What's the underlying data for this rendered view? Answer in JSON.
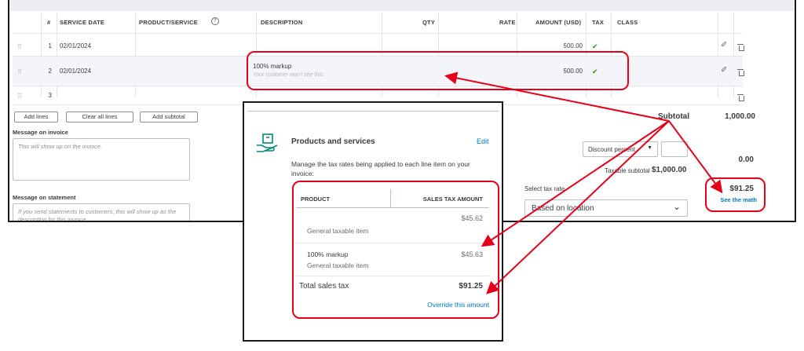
{
  "table": {
    "headers": {
      "num": "#",
      "service_date": "SERVICE DATE",
      "product_service": "PRODUCT/SERVICE",
      "description": "DESCRIPTION",
      "qty": "QTY",
      "rate": "RATE",
      "amount": "AMOUNT (USD)",
      "tax": "TAX",
      "class": "CLASS"
    },
    "rows": [
      {
        "num": "1",
        "date": "02/01/2024",
        "description": "",
        "description_sub": "",
        "amount": "500.00",
        "tax": "✔"
      },
      {
        "num": "2",
        "date": "02/01/2024",
        "description": "100% markup",
        "description_sub": "Your customer won't see this.",
        "amount": "500.00",
        "tax": "✔"
      },
      {
        "num": "3",
        "date": "",
        "description": "",
        "description_sub": "",
        "amount": "",
        "tax": ""
      }
    ]
  },
  "actions": {
    "add_lines": "Add lines",
    "clear_all_lines": "Clear all lines",
    "add_subtotal": "Add subtotal"
  },
  "message_invoice": {
    "label": "Message on invoice",
    "placeholder": "This will show up on the invoice."
  },
  "message_statement": {
    "label": "Message on statement",
    "placeholder": "If you send statements to customers, this will show up as the description for this invoice."
  },
  "totals": {
    "subtotal_label": "Subtotal",
    "subtotal_value": "1,000.00",
    "discount_label": "Discount percent",
    "discount_value": "0.00",
    "taxable_subtotal_label": "Taxable subtotal",
    "taxable_subtotal_value": "$1,000.00",
    "select_tax_rate_label": "Select tax rate",
    "tax_rate_value": "Based on location",
    "tax_total": "$91.25",
    "see_the_math": "See the math"
  },
  "popup": {
    "title": "Products and services",
    "edit": "Edit",
    "description": "Manage the tax rates being applied to each line item on your invoice:",
    "col_product": "PRODUCT",
    "col_sales_tax": "SALES TAX AMOUNT",
    "items": [
      {
        "name": "",
        "sub": "General taxable item",
        "amount": "$45.62"
      },
      {
        "name": "100% markup",
        "sub": "General taxable item",
        "amount": "$45.63"
      }
    ],
    "total_label": "Total sales tax",
    "total_value": "$91.25",
    "override": "Override this amount"
  },
  "colors": {
    "accent_green": "#2ca01c",
    "link_blue": "#0077c5",
    "annotation_red": "#e4001b",
    "icon_teal": "#00897b"
  }
}
